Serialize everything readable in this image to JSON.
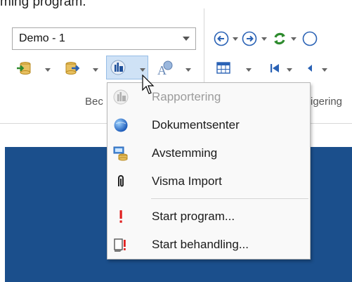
{
  "window": {
    "title_fragment": "ming program."
  },
  "ribbon": {
    "company_select": {
      "value": "Demo - 1"
    },
    "group_labels": {
      "left": "Bec",
      "right": "igering"
    }
  },
  "menu": {
    "items": [
      {
        "label": "Rapportering",
        "icon": "report-icon",
        "enabled": false
      },
      {
        "label": "Dokumentsenter",
        "icon": "globe-document-icon",
        "enabled": true
      },
      {
        "label": "Avstemming",
        "icon": "reconcile-icon",
        "enabled": true
      },
      {
        "label": "Visma Import",
        "icon": "paperclip-icon",
        "enabled": true
      },
      {
        "label": "Start program...",
        "icon": "exclamation-icon",
        "enabled": true
      },
      {
        "label": "Start behandling...",
        "icon": "start-processing-icon",
        "enabled": true
      }
    ]
  },
  "colors": {
    "workspace_blue": "#1b4f8c",
    "active_button": "#cfe2f6",
    "nav_blue": "#2a62b5",
    "refresh_green": "#2e8b2e",
    "warning_red": "#e02020"
  }
}
